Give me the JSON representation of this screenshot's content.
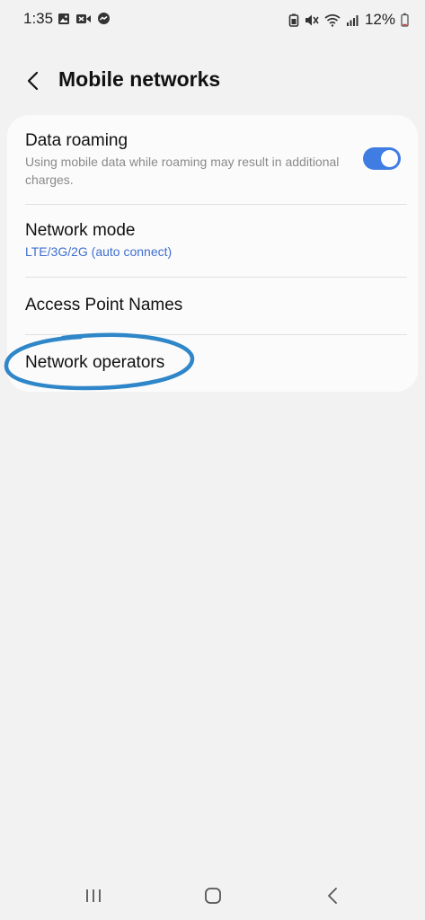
{
  "status_bar": {
    "time": "1:35",
    "left_icons": [
      "gallery-icon",
      "video-call-icon",
      "messenger-icon"
    ],
    "right_icons": [
      "battery-saver-icon",
      "mute-icon",
      "wifi-icon",
      "signal-icon"
    ],
    "battery_percent": "12%"
  },
  "header": {
    "title": "Mobile networks"
  },
  "settings": {
    "data_roaming": {
      "title": "Data roaming",
      "subtitle": "Using mobile data while roaming may result in additional charges.",
      "enabled": true
    },
    "network_mode": {
      "title": "Network mode",
      "value": "LTE/3G/2G (auto connect)"
    },
    "access_point_names": {
      "title": "Access Point Names"
    },
    "network_operators": {
      "title": "Network operators",
      "highlighted": true
    }
  },
  "colors": {
    "accent": "#3f7de3",
    "link_blue": "#3f6fd0",
    "highlight_circle": "#2f86c8",
    "background": "#f2f2f2",
    "card": "#fbfbfb"
  },
  "nav_bar": {
    "buttons": [
      "recent-apps-icon",
      "home-icon",
      "back-icon"
    ]
  }
}
